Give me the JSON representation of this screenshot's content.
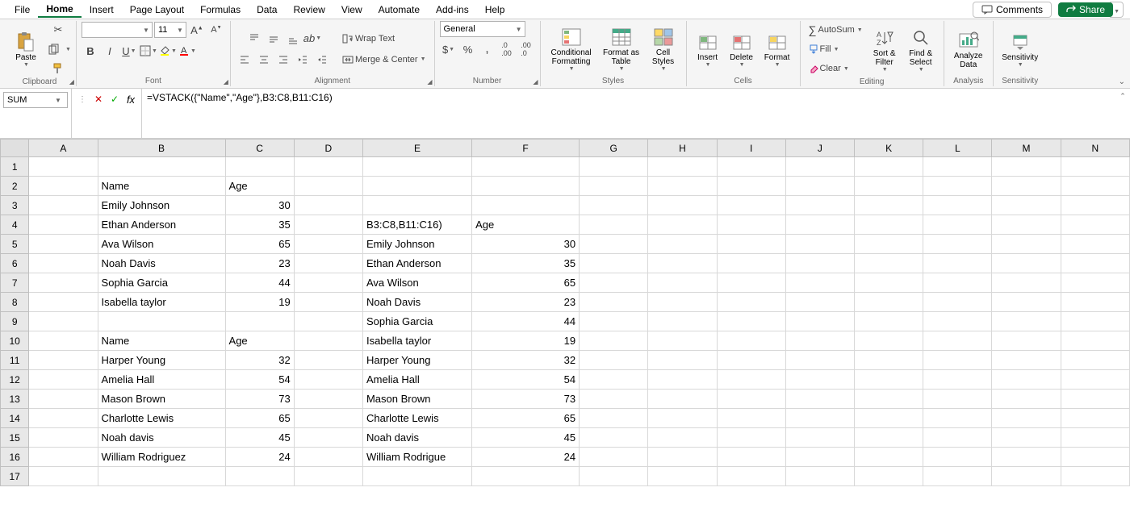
{
  "menu": {
    "items": [
      "File",
      "Home",
      "Insert",
      "Page Layout",
      "Formulas",
      "Data",
      "Review",
      "View",
      "Automate",
      "Add-ins",
      "Help"
    ],
    "active": "Home",
    "comments": "Comments",
    "share": "Share"
  },
  "ribbon": {
    "clipboard": {
      "paste": "Paste",
      "label": "Clipboard"
    },
    "font": {
      "name": "",
      "size": "11",
      "label": "Font"
    },
    "alignment": {
      "wrap": "Wrap Text",
      "merge": "Merge & Center",
      "label": "Alignment"
    },
    "number": {
      "format": "General",
      "label": "Number"
    },
    "styles": {
      "cond": "Conditional Formatting",
      "fmt_table": "Format as Table",
      "cell": "Cell Styles",
      "label": "Styles"
    },
    "cells": {
      "insert": "Insert",
      "delete": "Delete",
      "format": "Format",
      "label": "Cells"
    },
    "editing": {
      "autosum": "AutoSum",
      "fill": "Fill",
      "clear": "Clear",
      "sort": "Sort & Filter",
      "find": "Find & Select",
      "label": "Editing"
    },
    "analysis": {
      "analyze": "Analyze Data",
      "label": "Analysis"
    },
    "sensitivity": {
      "sensitivity": "Sensitivity",
      "label": "Sensitivity"
    }
  },
  "formula_bar": {
    "name_box": "SUM",
    "formula": "=VSTACK({\"Name\",\"Age\"},B3:C8,B11:C16)"
  },
  "grid": {
    "columns": [
      "A",
      "B",
      "C",
      "D",
      "E",
      "F",
      "G",
      "H",
      "I",
      "J",
      "K",
      "L",
      "M",
      "N"
    ],
    "rows": [
      {
        "r": 1
      },
      {
        "r": 2,
        "B": "Name",
        "C": "Age"
      },
      {
        "r": 3,
        "B": "Emily Johnson",
        "C": 30
      },
      {
        "r": 4,
        "B": "Ethan Anderson",
        "C": 35,
        "E": "B3:C8,B11:C16)",
        "F": "Age"
      },
      {
        "r": 5,
        "B": "Ava Wilson",
        "C": 65,
        "E": "Emily Johnson",
        "F": 30
      },
      {
        "r": 6,
        "B": "Noah Davis",
        "C": 23,
        "E": "Ethan Anderson",
        "F": 35
      },
      {
        "r": 7,
        "B": "Sophia Garcia",
        "C": 44,
        "E": "Ava Wilson",
        "F": 65
      },
      {
        "r": 8,
        "B": "Isabella taylor",
        "C": 19,
        "E": "Noah Davis",
        "F": 23
      },
      {
        "r": 9,
        "E": "Sophia Garcia",
        "F": 44
      },
      {
        "r": 10,
        "B": "Name",
        "C": "Age",
        "E": "Isabella taylor",
        "F": 19
      },
      {
        "r": 11,
        "B": "Harper Young",
        "C": 32,
        "E": "Harper Young",
        "F": 32
      },
      {
        "r": 12,
        "B": "Amelia Hall",
        "C": 54,
        "E": "Amelia Hall",
        "F": 54
      },
      {
        "r": 13,
        "B": "Mason Brown",
        "C": 73,
        "E": "Mason Brown",
        "F": 73
      },
      {
        "r": 14,
        "B": "Charlotte Lewis",
        "C": 65,
        "E": "Charlotte Lewis",
        "F": 65
      },
      {
        "r": 15,
        "B": "Noah davis",
        "C": 45,
        "E": "Noah davis",
        "F": 45
      },
      {
        "r": 16,
        "B": "William Rodriguez",
        "C": 24,
        "E": "William Rodrigue",
        "F": 24
      },
      {
        "r": 17
      }
    ]
  }
}
